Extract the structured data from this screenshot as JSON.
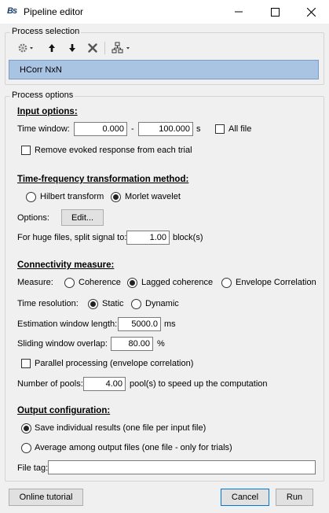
{
  "window": {
    "title": "Pipeline editor",
    "app_icon_text": "Bs"
  },
  "process_selection": {
    "label": "Process selection",
    "items": [
      "HCorr NxN"
    ]
  },
  "process_options": {
    "label": "Process options",
    "input": {
      "heading": "Input options:",
      "time_window_label": "Time window:",
      "start": "0.000",
      "dash": "-",
      "end": "100.000",
      "unit": "s",
      "all_file_label": "All file",
      "remove_evoked_label": "Remove evoked response from each trial"
    },
    "tf": {
      "heading": "Time-frequency transformation method:",
      "hilbert_label": "Hilbert transform",
      "morlet_label": "Morlet wavelet",
      "options_label": "Options:",
      "edit_label": "Edit...",
      "split_label": "For huge files, split signal to:",
      "split_value": "1.00",
      "split_unit": "block(s)"
    },
    "conn": {
      "heading": "Connectivity measure:",
      "measure_label": "Measure:",
      "coherence_label": "Coherence",
      "lagged_label": "Lagged coherence",
      "envelope_label": "Envelope Correlation",
      "time_res_label": "Time resolution:",
      "static_label": "Static",
      "dynamic_label": "Dynamic",
      "est_window_label": "Estimation window length:",
      "est_window_value": "5000.0",
      "est_window_unit": "ms",
      "overlap_label": "Sliding window overlap:",
      "overlap_value": "80.00",
      "overlap_unit": "%",
      "parallel_label": "Parallel processing (envelope correlation)",
      "pools_label": "Number of pools:",
      "pools_value": "4.00",
      "pools_unit": "pool(s) to speed up the computation"
    },
    "output": {
      "heading": "Output configuration:",
      "save_individual_label": "Save individual results (one file per input file)",
      "average_label": "Average among output files (one file - only for trials)",
      "file_tag_label": "File tag:",
      "file_tag_value": ""
    }
  },
  "footer": {
    "tutorial_label": "Online tutorial",
    "cancel_label": "Cancel",
    "run_label": "Run"
  }
}
